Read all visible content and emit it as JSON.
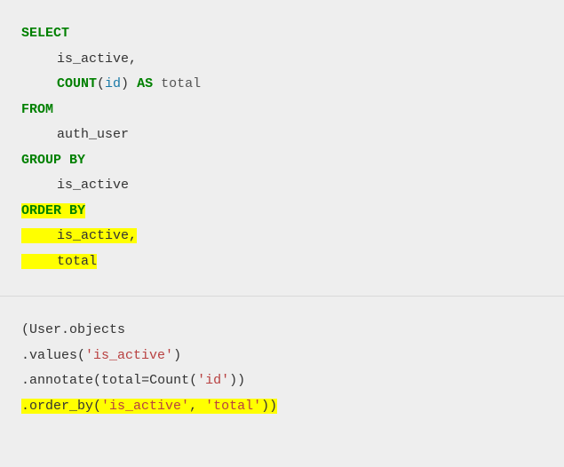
{
  "sql": {
    "select": "SELECT",
    "col1": "is_active,",
    "count": "COUNT",
    "paren_open": "(",
    "count_arg": "id",
    "paren_close": ")",
    "as": "AS",
    "alias": "total",
    "from": "FROM",
    "table": "auth_user",
    "group_by": "GROUP BY",
    "group_col": "is_active",
    "order_by": "ORDER BY",
    "ob_col1": "is_active,",
    "ob_col2": "total"
  },
  "py": {
    "l1_open": "(",
    "l1_user": "User",
    "l1_dot": ".",
    "l1_objects": "objects",
    "l2_dot": ".",
    "l2_values": "values",
    "l2_open": "(",
    "l2_arg": "'is_active'",
    "l2_close": ")",
    "l3_dot": ".",
    "l3_annotate": "annotate",
    "l3_open": "(",
    "l3_kw": "total",
    "l3_eq": "=",
    "l3_count": "Count",
    "l3_copen": "(",
    "l3_carg": "'id'",
    "l3_cclose": "))",
    "l4_dot": ".",
    "l4_order_by": "order_by",
    "l4_open": "(",
    "l4_arg1": "'is_active'",
    "l4_comma": ", ",
    "l4_arg2": "'total'",
    "l4_close": "))"
  }
}
